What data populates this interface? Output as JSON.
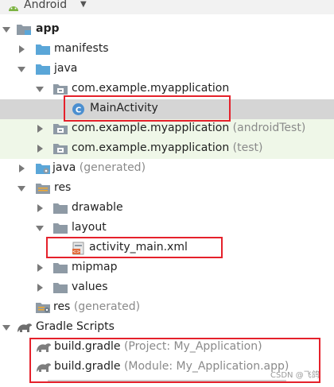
{
  "header": {
    "view_label": "Android"
  },
  "tree": {
    "app": "app",
    "manifests": "manifests",
    "java": "java",
    "pkg_main": "com.example.myapplication",
    "main_activity": "MainActivity",
    "pkg_android_test": "com.example.myapplication",
    "pkg_android_test_suffix": "(androidTest)",
    "pkg_test": "com.example.myapplication",
    "pkg_test_suffix": "(test)",
    "java_generated": "java",
    "java_generated_suffix": "(generated)",
    "res": "res",
    "drawable": "drawable",
    "layout": "layout",
    "activity_main": "activity_main.xml",
    "mipmap": "mipmap",
    "values": "values",
    "res_generated": "res",
    "res_generated_suffix": "(generated)",
    "gradle_scripts": "Gradle Scripts",
    "build_gradle_project": "build.gradle",
    "build_gradle_project_suffix": "(Project: My_Application)",
    "build_gradle_module": "build.gradle",
    "build_gradle_module_suffix": "(Module: My_Application.app)"
  },
  "watermark": "CSDN @飞鸽",
  "colors": {
    "highlight_red": "#e5212b",
    "selected_row": "#d5d5d5",
    "test_row_green": "#eff7e8",
    "folder_blue": "#5aa6d8",
    "folder_gray": "#8e9aa5",
    "class_icon": "#4b8fd0"
  }
}
